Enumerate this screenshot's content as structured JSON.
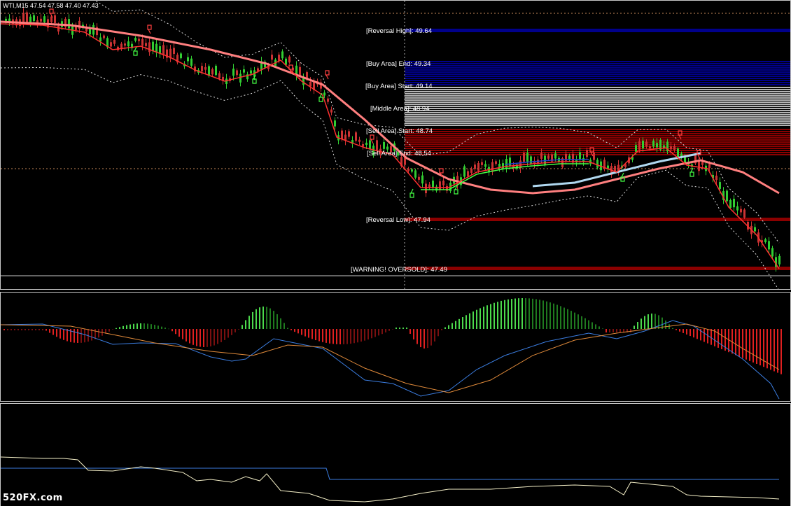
{
  "symbol": {
    "info": "WTI,M15  47.54 47.58 47.40 47.43"
  },
  "levels": [
    {
      "id": "reversal-high",
      "label": "[Reversal High]: 49.64"
    },
    {
      "id": "buy-area-end",
      "label": "[Buy Area] End: 49.34"
    },
    {
      "id": "buy-area-start",
      "label": "[Buy Area] Start: 49.14"
    },
    {
      "id": "middle-area",
      "label": "[Middle Area]: 48.94"
    },
    {
      "id": "sell-area-start",
      "label": "[Sell Area] Start: 48.74"
    },
    {
      "id": "sell-area-end",
      "label": "[Sell Area] End: 48.54"
    },
    {
      "id": "reversal-low",
      "label": "[Reversal Low]: 47.94"
    },
    {
      "id": "warning-oversold",
      "label": "[WARNING! OVERSOLD]: 47.49"
    }
  ],
  "colors": {
    "background": "#000000",
    "buy_area": "#00008b",
    "middle_area": "#c8c8c8",
    "sell_area": "#8b0000",
    "bull_candle": "#32cd32",
    "bear_candle": "#cc3333",
    "ma_fast": "#ff3030",
    "ma_slow": "#ff7f7f",
    "macd_line": "#3b7de0",
    "signal_line": "#e08a3a",
    "hist_pos": "#4cd94c",
    "hist_neg": "#e02020"
  },
  "watermark": {
    "text": "520FX.com"
  }
}
